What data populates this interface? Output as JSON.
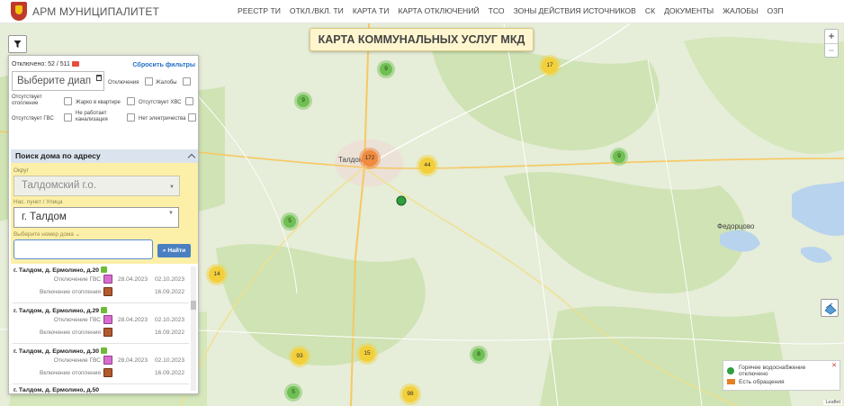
{
  "header": {
    "brand": "АРМ МУНИЦИПАЛИТЕТ",
    "nav": [
      "РЕЕСТР ТИ",
      "ОТКЛ./ВКЛ. ТИ",
      "КАРТА ТИ",
      "КАРТА ОТКЛЮЧЕНИЙ",
      "ТСО",
      "ЗОНЫ ДЕЙСТВИЯ ИСТОЧНИКОВ",
      "СК",
      "ДОКУМЕНТЫ",
      "ЖАЛОБЫ",
      "ОЗП"
    ]
  },
  "map": {
    "banner": "КАРТА КОММУНАЛЬНЫХ УСЛУГ МКД",
    "labels": {
      "taldom": "Талдом",
      "fedortsovo": "Федорцово"
    },
    "clusters": [
      {
        "count": "9",
        "color": "green"
      },
      {
        "count": "17",
        "color": "yellow"
      },
      {
        "count": "9",
        "color": "green"
      },
      {
        "count": "172",
        "color": "orange"
      },
      {
        "count": "44",
        "color": "yellow"
      },
      {
        "count": "9",
        "color": "green"
      },
      {
        "count": "5",
        "color": "green"
      },
      {
        "count": "14",
        "color": "yellow"
      },
      {
        "count": "93",
        "color": "yellow"
      },
      {
        "count": "15",
        "color": "yellow"
      },
      {
        "count": "8",
        "color": "green"
      },
      {
        "count": "5",
        "color": "green"
      },
      {
        "count": "98",
        "color": "yellow"
      }
    ],
    "zoom_in": "+",
    "zoom_out": "−",
    "legend": {
      "hot_water_off": "Горячее водоснабжение отключено",
      "complaints": "Есть обращения",
      "close": "✕"
    },
    "attribution": "Leaflet"
  },
  "panel": {
    "off_count": "Отключено: 52 / 511",
    "reset": "Сбросить фильтры",
    "date_placeholder": "Выберите диап",
    "filters": {
      "outages": "Отключения",
      "complaints": "Жалобы",
      "no_heating": "Отсутствует отопление",
      "hot_apartment": "Жарко в квартире",
      "no_cold_water": "Отсутствует ХВС",
      "no_hot_water": "Отсутствует ГВС",
      "sewer": "Не работает канализация",
      "no_power": "Нет электричества"
    },
    "search": {
      "title": "Поиск дома по адресу",
      "district_label": "Округ",
      "district_value": "Талдомский г.о.",
      "street_label": "Нас. пункт / Улица",
      "street_value": "г. Талдом",
      "house_label": "Выберите номер дома",
      "find_button": "Найти"
    },
    "results": [
      {
        "address": "г. Талдом, д. Ермолино, д.20",
        "off_label": "Отключение ГВС",
        "off_from": "28.04.2023",
        "off_to": "02.10.2023",
        "on_label": "Включение отопления",
        "on_date": "16.09.2022"
      },
      {
        "address": "г. Талдом, д. Ермолино, д.29",
        "off_label": "Отключение ГВС",
        "off_from": "28.04.2023",
        "off_to": "02.10.2023",
        "on_label": "Включение отопления",
        "on_date": "16.09.2022"
      },
      {
        "address": "г. Талдом, д. Ермолино, д.30",
        "off_label": "Отключение ГВС",
        "off_from": "28.04.2023",
        "off_to": "02.10.2023",
        "on_label": "Включение отопления",
        "on_date": "16.09.2022"
      }
    ],
    "partial_result": "г. Талдом, д. Ермолино, д.50"
  },
  "colors": {
    "marker_green": "#2e9e3e",
    "cluster_yellow": "#f3d03a",
    "cluster_orange": "#f08a3e",
    "search_bg": "#fcefa8",
    "link_blue": "#2471c6"
  }
}
